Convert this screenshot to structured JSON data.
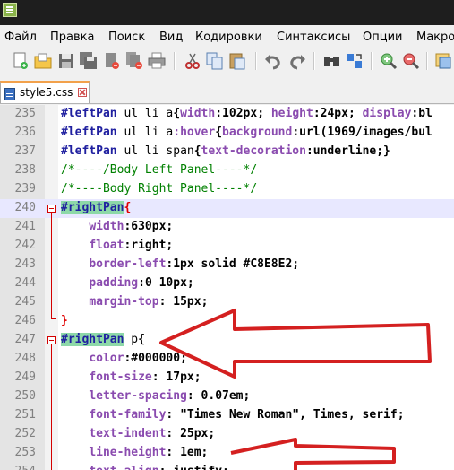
{
  "menubar": {
    "items": [
      "Файл",
      "Правка",
      "Поиск",
      "Вид",
      "Кодировки",
      "Синтаксисы",
      "Опции",
      "Макро"
    ]
  },
  "toolbar": {
    "icons": [
      "new-file-icon",
      "open-file-icon",
      "save-icon",
      "save-all-icon",
      "close-icon",
      "close-all-icon",
      "print-icon",
      "cut-icon",
      "copy-icon",
      "paste-icon",
      "undo-icon",
      "redo-icon",
      "find-icon",
      "replace-icon",
      "zoom-in-icon",
      "zoom-out-icon",
      "sync-icon"
    ]
  },
  "tab": {
    "label": "style5.css",
    "accent": "#f2a14b"
  },
  "colors": {
    "selector_id": "#2020a0",
    "property": "#8a4baf",
    "comment": "#008000",
    "brace": "#e00000",
    "highlight": "#8dd8a8",
    "current_line": "#e8e8ff",
    "arrow": "#d42020"
  },
  "lines": [
    {
      "num": "235",
      "tokens": [
        {
          "c": "t-id",
          "t": "#leftPan"
        },
        {
          "c": "t-tag",
          "t": " ul li a"
        },
        {
          "c": "t-punc",
          "t": "{"
        },
        {
          "c": "t-prop",
          "t": "width"
        },
        {
          "c": "t-punc",
          "t": ":"
        },
        {
          "c": "t-val",
          "t": "102px"
        },
        {
          "c": "t-punc",
          "t": "; "
        },
        {
          "c": "t-prop",
          "t": "height"
        },
        {
          "c": "t-punc",
          "t": ":"
        },
        {
          "c": "t-val",
          "t": "24px"
        },
        {
          "c": "t-punc",
          "t": "; "
        },
        {
          "c": "t-prop",
          "t": "display"
        },
        {
          "c": "t-punc",
          "t": ":bl"
        }
      ]
    },
    {
      "num": "236",
      "tokens": [
        {
          "c": "t-id",
          "t": "#leftPan"
        },
        {
          "c": "t-tag",
          "t": " ul li a"
        },
        {
          "c": "t-pseudo",
          "t": ":hover"
        },
        {
          "c": "t-punc",
          "t": "{"
        },
        {
          "c": "t-prop",
          "t": "background"
        },
        {
          "c": "t-punc",
          "t": ":"
        },
        {
          "c": "t-val",
          "t": "url(1969/images/bul"
        }
      ]
    },
    {
      "num": "237",
      "tokens": [
        {
          "c": "t-id",
          "t": "#leftPan"
        },
        {
          "c": "t-tag",
          "t": " ul li span"
        },
        {
          "c": "t-punc",
          "t": "{"
        },
        {
          "c": "t-prop",
          "t": "text-decoration"
        },
        {
          "c": "t-punc",
          "t": ":"
        },
        {
          "c": "t-val",
          "t": "underline"
        },
        {
          "c": "t-punc",
          "t": ";}"
        }
      ]
    },
    {
      "num": "238",
      "tokens": [
        {
          "c": "t-cmt",
          "t": "/*----/Body Left Panel----*/"
        }
      ]
    },
    {
      "num": "239",
      "tokens": [
        {
          "c": "t-cmt",
          "t": "/*----Body Right Panel----*/"
        }
      ]
    },
    {
      "num": "240",
      "current": true,
      "tokens": [
        {
          "c": "t-id hl",
          "t": "#rightPan"
        },
        {
          "c": "t-brace",
          "t": "{"
        }
      ]
    },
    {
      "num": "241",
      "tokens": [
        {
          "c": "t-punc",
          "t": "    "
        },
        {
          "c": "t-prop",
          "t": "width"
        },
        {
          "c": "t-punc",
          "t": ":"
        },
        {
          "c": "t-val",
          "t": "630px"
        },
        {
          "c": "t-punc",
          "t": ";"
        }
      ]
    },
    {
      "num": "242",
      "tokens": [
        {
          "c": "t-punc",
          "t": "    "
        },
        {
          "c": "t-prop",
          "t": "float"
        },
        {
          "c": "t-punc",
          "t": ":"
        },
        {
          "c": "t-val",
          "t": "right"
        },
        {
          "c": "t-punc",
          "t": ";"
        }
      ]
    },
    {
      "num": "243",
      "tokens": [
        {
          "c": "t-punc",
          "t": "    "
        },
        {
          "c": "t-prop",
          "t": "border-left"
        },
        {
          "c": "t-punc",
          "t": ":"
        },
        {
          "c": "t-val",
          "t": "1px solid #C8E8E2"
        },
        {
          "c": "t-punc",
          "t": ";"
        }
      ]
    },
    {
      "num": "244",
      "tokens": [
        {
          "c": "t-punc",
          "t": "    "
        },
        {
          "c": "t-prop",
          "t": "padding"
        },
        {
          "c": "t-punc",
          "t": ":"
        },
        {
          "c": "t-val",
          "t": "0 10px"
        },
        {
          "c": "t-punc",
          "t": ";"
        }
      ]
    },
    {
      "num": "245",
      "tokens": [
        {
          "c": "t-punc",
          "t": "    "
        },
        {
          "c": "t-prop",
          "t": "margin-top"
        },
        {
          "c": "t-punc",
          "t": ": "
        },
        {
          "c": "t-val",
          "t": "15px"
        },
        {
          "c": "t-punc",
          "t": ";"
        }
      ]
    },
    {
      "num": "246",
      "tokens": [
        {
          "c": "t-brace",
          "t": "}"
        }
      ]
    },
    {
      "num": "247",
      "tokens": [
        {
          "c": "t-id hl",
          "t": "#rightPan"
        },
        {
          "c": "t-tag",
          "t": " p"
        },
        {
          "c": "t-punc",
          "t": "{"
        }
      ]
    },
    {
      "num": "248",
      "tokens": [
        {
          "c": "t-punc",
          "t": "    "
        },
        {
          "c": "t-prop",
          "t": "color"
        },
        {
          "c": "t-punc",
          "t": ":"
        },
        {
          "c": "t-val",
          "t": "#000000"
        },
        {
          "c": "t-punc",
          "t": ";"
        }
      ]
    },
    {
      "num": "249",
      "tokens": [
        {
          "c": "t-punc",
          "t": "    "
        },
        {
          "c": "t-prop",
          "t": "font-size"
        },
        {
          "c": "t-punc",
          "t": ": "
        },
        {
          "c": "t-val",
          "t": "17px"
        },
        {
          "c": "t-punc",
          "t": ";"
        }
      ]
    },
    {
      "num": "250",
      "tokens": [
        {
          "c": "t-punc",
          "t": "    "
        },
        {
          "c": "t-prop",
          "t": "letter-spacing"
        },
        {
          "c": "t-punc",
          "t": ": "
        },
        {
          "c": "t-val",
          "t": "0.07em"
        },
        {
          "c": "t-punc",
          "t": ";"
        }
      ]
    },
    {
      "num": "251",
      "tokens": [
        {
          "c": "t-punc",
          "t": "    "
        },
        {
          "c": "t-prop",
          "t": "font-family"
        },
        {
          "c": "t-punc",
          "t": ": "
        },
        {
          "c": "t-val",
          "t": "\"Times New Roman\", Times, serif"
        },
        {
          "c": "t-punc",
          "t": ";"
        }
      ]
    },
    {
      "num": "252",
      "tokens": [
        {
          "c": "t-punc",
          "t": "    "
        },
        {
          "c": "t-prop",
          "t": "text-indent"
        },
        {
          "c": "t-punc",
          "t": ": "
        },
        {
          "c": "t-val",
          "t": "25px"
        },
        {
          "c": "t-punc",
          "t": ";"
        }
      ]
    },
    {
      "num": "253",
      "tokens": [
        {
          "c": "t-punc",
          "t": "    "
        },
        {
          "c": "t-prop",
          "t": "line-height"
        },
        {
          "c": "t-punc",
          "t": ": "
        },
        {
          "c": "t-val",
          "t": "1em"
        },
        {
          "c": "t-punc",
          "t": ";"
        }
      ]
    },
    {
      "num": "254",
      "tokens": [
        {
          "c": "t-punc",
          "t": "    "
        },
        {
          "c": "t-prop",
          "t": "text-align"
        },
        {
          "c": "t-punc",
          "t": ": "
        },
        {
          "c": "t-val",
          "t": "justify"
        },
        {
          "c": "t-punc",
          "t": ";"
        }
      ]
    }
  ]
}
